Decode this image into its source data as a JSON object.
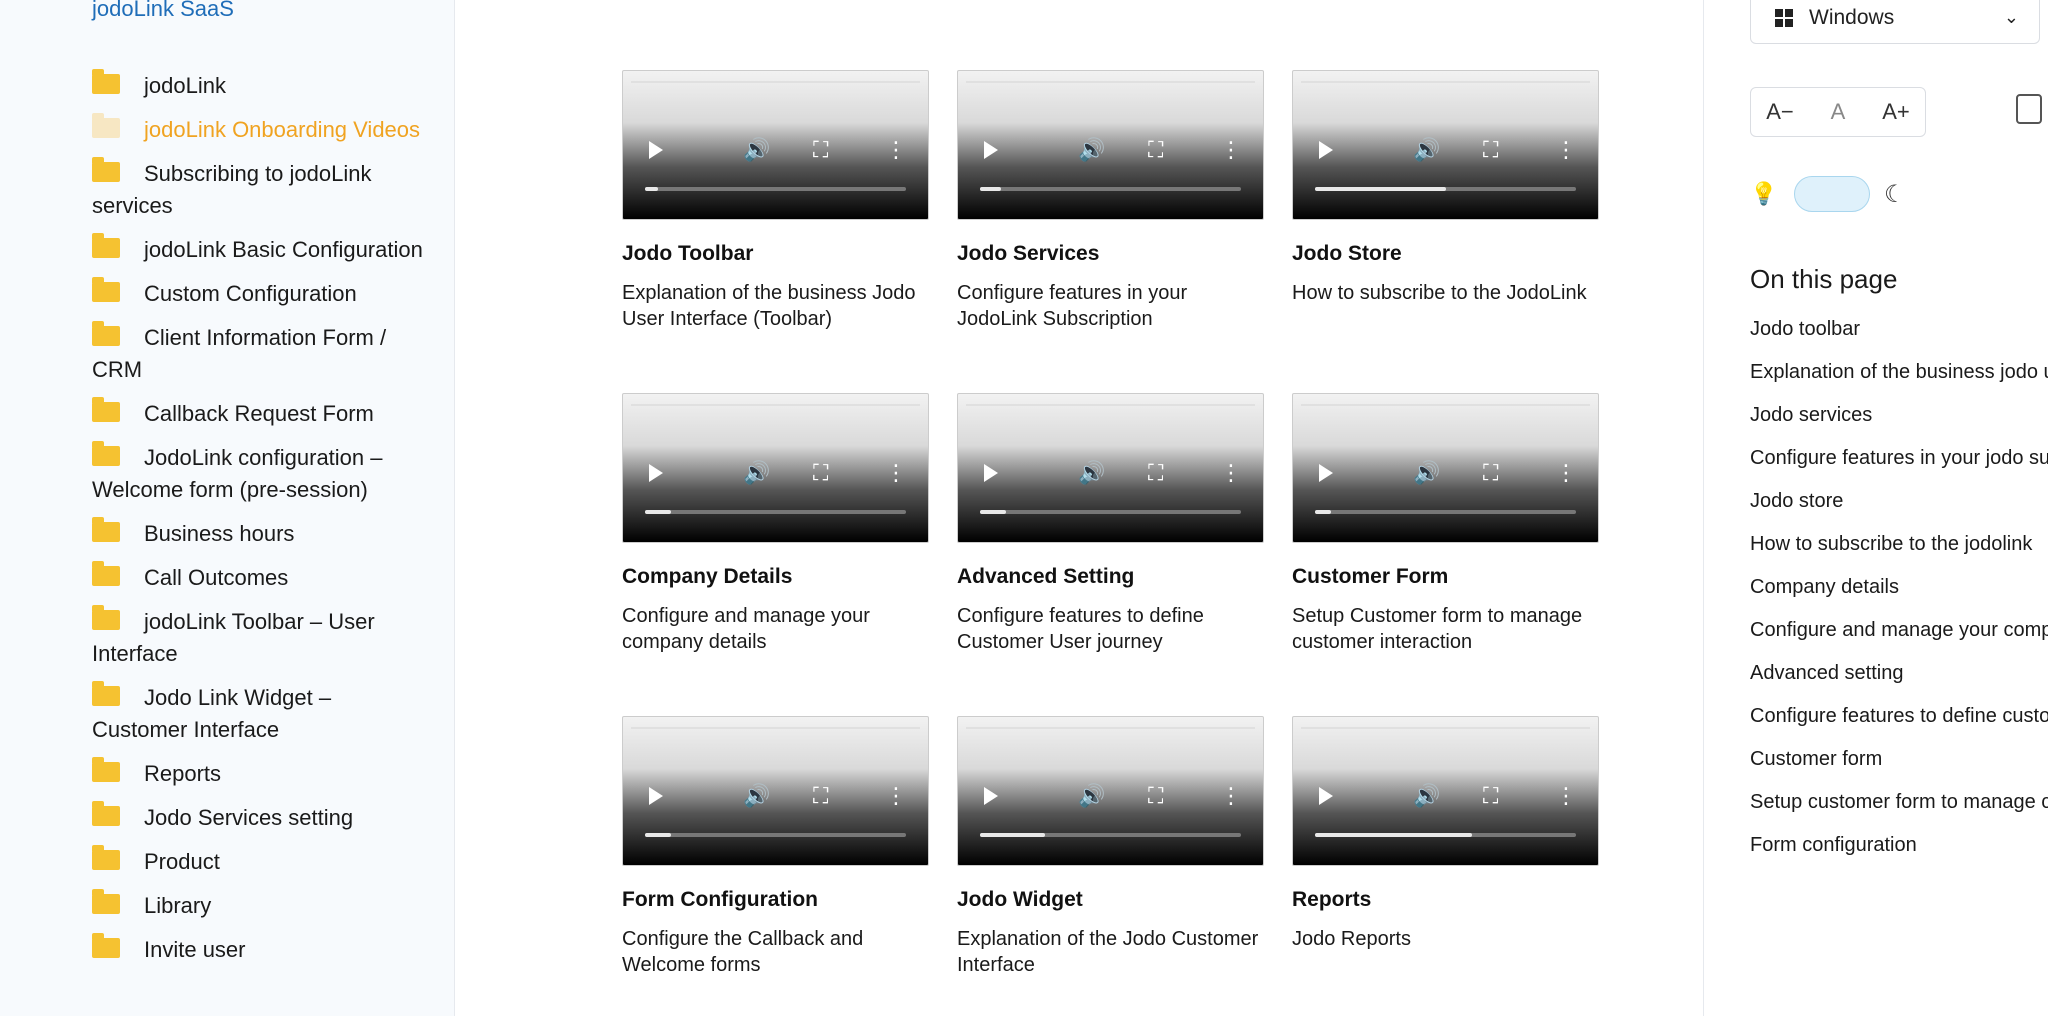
{
  "sidebar": {
    "brand": "jodoLink SaaS",
    "items": [
      {
        "label": "jodoLink",
        "active": false
      },
      {
        "label": "jodoLink Onboarding Videos",
        "active": true
      },
      {
        "label": "Subscribing to jodoLink services",
        "active": false
      },
      {
        "label": "jodoLink Basic Configuration",
        "active": false
      },
      {
        "label": "Custom Configuration",
        "active": false
      },
      {
        "label": "Client Information Form / CRM",
        "active": false
      },
      {
        "label": "Callback Request Form",
        "active": false
      },
      {
        "label": "JodoLink configuration – Welcome form (pre-session)",
        "active": false
      },
      {
        "label": "Business hours",
        "active": false
      },
      {
        "label": "Call Outcomes",
        "active": false
      },
      {
        "label": "jodoLink Toolbar – User Interface",
        "active": false
      },
      {
        "label": "Jodo Link Widget – Customer Interface",
        "active": false
      },
      {
        "label": "Reports",
        "active": false
      },
      {
        "label": "Jodo Services setting",
        "active": false
      },
      {
        "label": "Product",
        "active": false
      },
      {
        "label": "Library",
        "active": false
      },
      {
        "label": "Invite user",
        "active": false
      }
    ]
  },
  "cards": [
    {
      "title": "Jodo Toolbar",
      "desc": "Explanation of the business Jodo User Interface (Toolbar)",
      "progress": 0.05
    },
    {
      "title": "Jodo Services",
      "desc": "Configure features in your JodoLink Subscription",
      "progress": 0.08
    },
    {
      "title": "Jodo Store",
      "desc": "How to subscribe to the JodoLink",
      "progress": 0.5
    },
    {
      "title": "Company Details",
      "desc": "Configure and manage your company details",
      "progress": 0.1
    },
    {
      "title": "Advanced Setting",
      "desc": "Configure features to define Customer User journey",
      "progress": 0.1
    },
    {
      "title": "Customer Form",
      "desc": "Setup Customer form to manage customer interaction",
      "progress": 0.06
    },
    {
      "title": "Form Configuration",
      "desc": "Configure the Callback and Welcome forms",
      "progress": 0.1
    },
    {
      "title": "Jodo Widget",
      "desc": "Explanation of the Jodo Customer Interface",
      "progress": 0.25
    },
    {
      "title": "Reports",
      "desc": "Jodo Reports",
      "progress": 0.6
    }
  ],
  "right_panel": {
    "os_select": "Windows",
    "font_buttons": [
      "A−",
      "A",
      "A+"
    ],
    "toc_title": "On this page",
    "toc_items": [
      "Jodo toolbar",
      "Explanation of the business jodo user interface toolbar",
      "Jodo services",
      "Configure features in your jodo subscription",
      "Jodo store",
      "How to subscribe to the jodolink",
      "Company details",
      "Configure and manage your company details",
      "Advanced setting",
      "Configure features to define customer user journey",
      "Customer form",
      "Setup customer form to manage customer interaction",
      "Form configuration"
    ]
  }
}
